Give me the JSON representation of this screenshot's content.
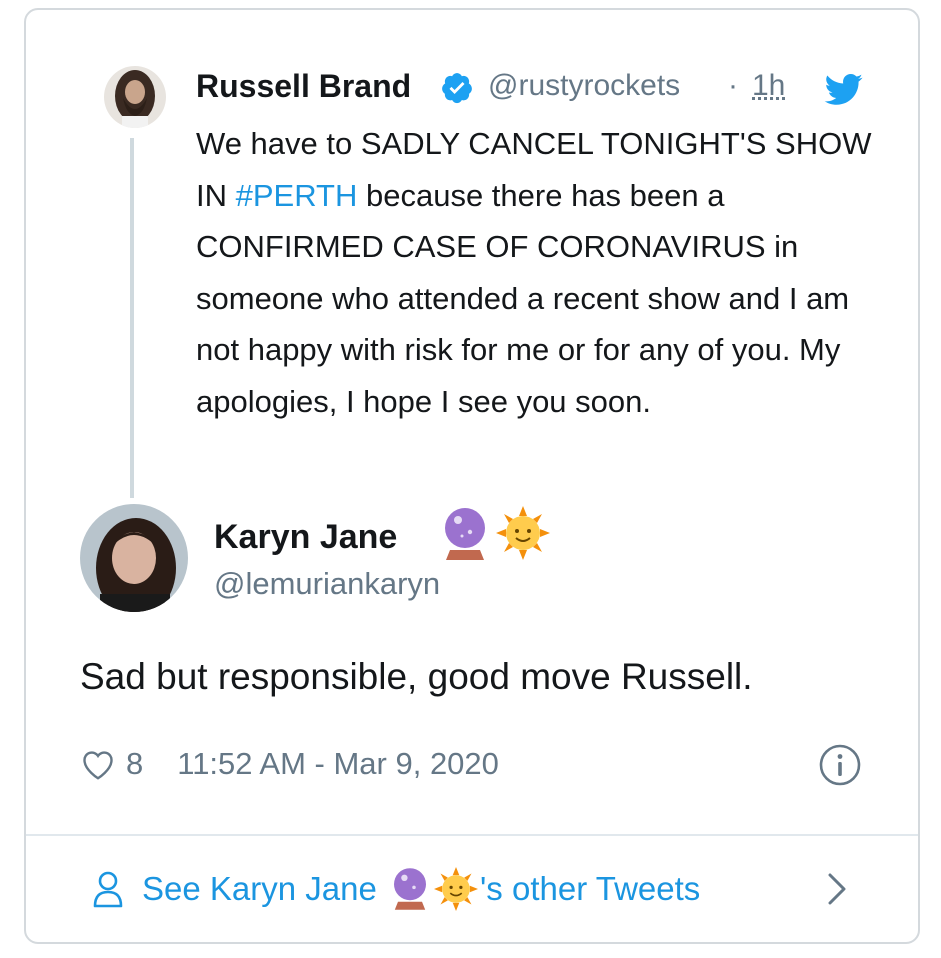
{
  "quoted_tweet": {
    "author_name": "Russell Brand",
    "handle": "@rustyrockets",
    "separator": "·",
    "time": "1h",
    "text_before": "We have to SADLY CANCEL TONIGHT'S SHOW IN ",
    "hashtag": "#PERTH",
    "text_after": " because there has been a CONFIRMED CASE OF CORONAVIRUS in someone who attended a recent show and I am not happy with risk for me or for any of you. My apologies, I hope I see you soon."
  },
  "reply_tweet": {
    "author_name": "Karyn Jane",
    "handle": "@lemuriankaryn",
    "text": "Sad but responsible, good move Russell.",
    "like_count": "8",
    "timestamp": "11:52 AM - Mar 9, 2020"
  },
  "footer": {
    "prefix": "See Karyn Jane ",
    "suffix": "'s other Tweets"
  },
  "colors": {
    "link": "#1b95e0",
    "secondary_text": "#657786",
    "border": "#d4d9dd",
    "verified_badge": "#1da1f2"
  },
  "icons": [
    "verified-badge-icon",
    "twitter-bird-icon",
    "crystal-ball-emoji-icon",
    "sun-face-emoji-icon",
    "heart-icon",
    "info-icon",
    "person-icon",
    "chevron-right-icon"
  ]
}
